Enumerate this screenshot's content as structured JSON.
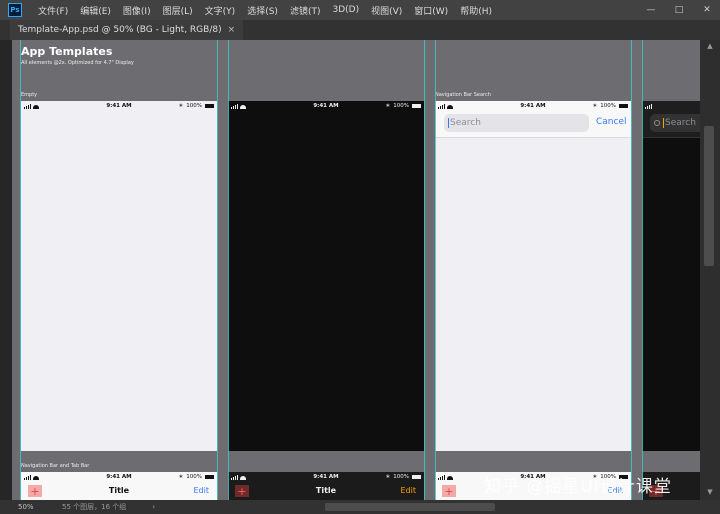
{
  "menubar": {
    "logo": "Ps",
    "items": [
      "文件(F)",
      "编辑(E)",
      "图像(I)",
      "图层(L)",
      "文字(Y)",
      "选择(S)",
      "滤镜(T)",
      "3D(D)",
      "视图(V)",
      "窗口(W)",
      "帮助(H)"
    ],
    "controls": [
      "minimize-icon",
      "maximize-icon",
      "close-icon"
    ]
  },
  "tab": {
    "title": "Template-App.psd @ 50% (BG - Light, RGB/8)",
    "close": "×"
  },
  "canvas": {
    "title": "App Templates",
    "subtitle": "All elements @2x. Optimized for 4.7\" Display",
    "label_empty": "Empty",
    "label_search": "Navigation Bar Search",
    "label_tab": "Navigation Bar and Tab Bar",
    "status_time": "9:41 AM",
    "battery": "100%",
    "search_placeholder": "Search",
    "cancel": "Cancel",
    "nav_title": "Title",
    "nav_edit": "Edit",
    "plus": "+"
  },
  "colors": {
    "accent_blue": "#3478f6",
    "accent_orange": "#ff9f0a",
    "guide": "#3fc8c8"
  },
  "statusline": {
    "zoom": "50%",
    "info": "55 个图层，16 个组",
    "arrow": "›"
  },
  "watermark": "知乎 @摇星UI设计课堂"
}
